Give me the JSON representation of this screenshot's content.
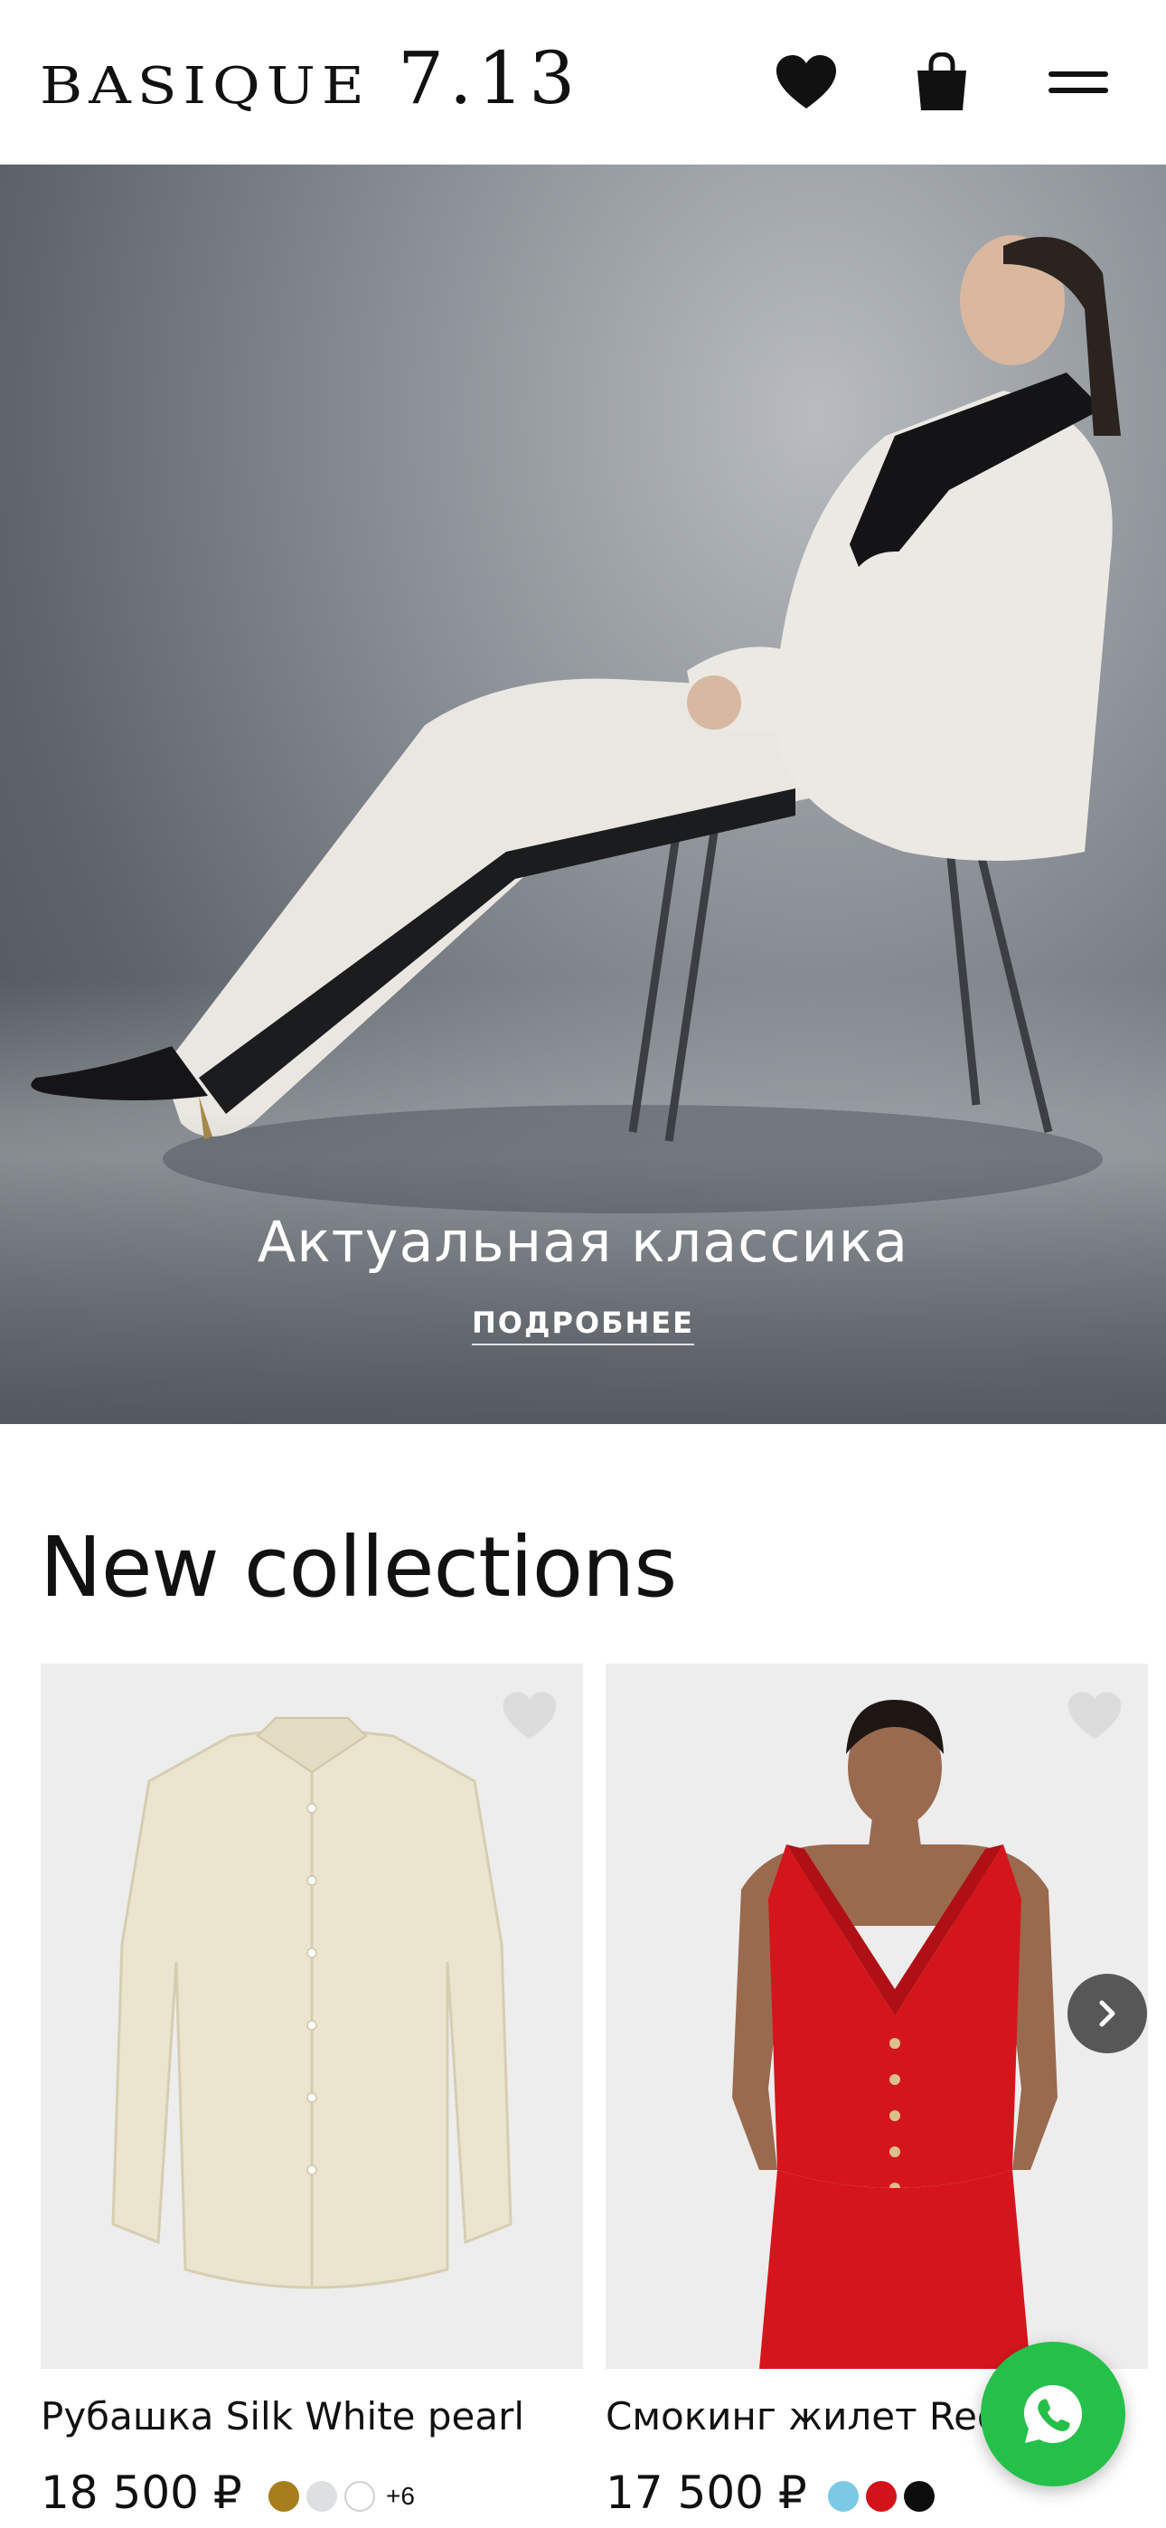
{
  "header": {
    "logo_word": "BASIQUE",
    "logo_number": "7.13",
    "favorites_icon": "heart-icon",
    "cart_icon": "shopping-bag-icon",
    "menu_icon": "hamburger-menu-icon"
  },
  "hero": {
    "title": "Актуальная классика",
    "link_label": "ПОДРОБНЕЕ"
  },
  "section": {
    "title": "New collections"
  },
  "products": [
    {
      "name": "Рубашка Silk White pearl",
      "price": "18 500 ₽",
      "swatches": [
        "#a87d1c",
        "#dedfe1",
        "#ffffff"
      ],
      "more_colors": "+6"
    },
    {
      "name": "Смокинг жилет Red",
      "price": "17 500 ₽",
      "swatches": [
        "#7cc9e6",
        "#d2141a",
        "#0d0d0d"
      ],
      "more_colors": ""
    }
  ],
  "carousel": {
    "next_icon": "chevron-right-icon"
  },
  "chat": {
    "icon": "whatsapp-icon"
  }
}
